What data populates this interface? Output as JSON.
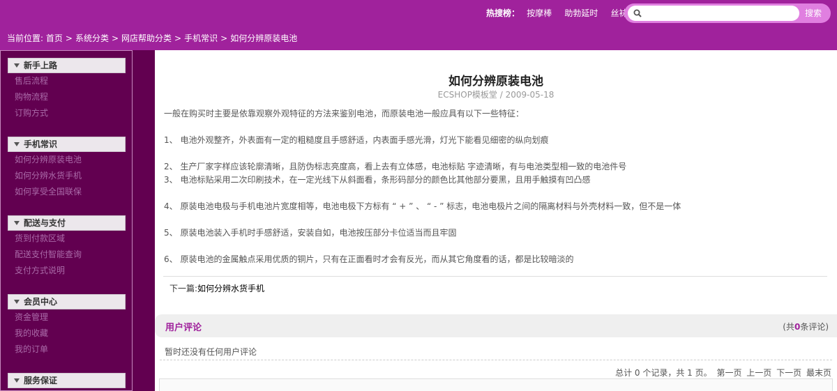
{
  "header": {
    "hot_label": "热搜榜：",
    "hot_links": [
      "按摩棒",
      "助勃延时",
      "丝袜"
    ],
    "search_placeholder": "",
    "search_button": "搜索"
  },
  "breadcrumb": {
    "prefix": "当前位置:",
    "items": [
      "首页",
      "系统分类",
      "网店帮助分类",
      "手机常识",
      "如何分辨原装电池"
    ],
    "separator": ">"
  },
  "sidebar": {
    "categories": [
      {
        "title": "新手上路",
        "items": [
          "售后流程",
          "购物流程",
          "订购方式"
        ]
      },
      {
        "title": "手机常识",
        "items": [
          "如何分辨原装电池",
          "如何分辨水货手机",
          "如何享受全国联保"
        ]
      },
      {
        "title": "配送与支付",
        "items": [
          "货到付款区域",
          "配送支付智能查询",
          "支付方式说明"
        ]
      },
      {
        "title": "会员中心",
        "items": [
          "资金管理",
          "我的收藏",
          "我的订单"
        ]
      },
      {
        "title": "服务保证",
        "items": []
      }
    ]
  },
  "article": {
    "title": "如何分辨原装电池",
    "meta": "ECSHOP模板堂 / 2009-05-18",
    "intro": "一般在购买时主要是依靠观察外观特征的方法来鉴别电池，而原装电池一般应具有以下一些特征：",
    "points": [
      "1、 电池外观整齐，外表面有一定的粗糙度且手感舒适，内表面手感光滑，灯光下能看见细密的纵向划痕",
      "2、 生产厂家字样应该轮廓清晰，且防伪标志亮度高，看上去有立体感，电池标贴 字迹清晰，有与电池类型相一致的电池件号",
      "3、 电池标贴采用二次印刷技术，在一定光线下从斜面看，条形码部分的颜色比其他部分要黑，且用手触摸有凹凸感",
      "4、 原装电池电极与手机电池片宽度相等，电池电极下方标有 “ + ” 、 “ - ” 标志，电池电极片之间的隔离材料与外壳材料一致，但不是一体",
      "5、 原装电池装入手机时手感舒适，安装自如，电池按压部分卡位适当而且牢固",
      "6、 原装电池的金属触点采用优质的铜片，只有在正面看时才会有反光，而从其它角度看的话，都是比较暗淡的"
    ],
    "next_label": "下一篇:",
    "next_title": "如何分辨水货手机"
  },
  "comments": {
    "title": "用户评论",
    "count_prefix": "(共",
    "count": "0",
    "count_suffix": "条评论)",
    "empty_text": "暂时还没有任何用户评论",
    "pager_info": "总计 0 个记录，共 1 页。",
    "pager_links": [
      "第一页",
      "上一页",
      "下一页",
      "最末页"
    ]
  },
  "colors": {
    "brand_purple": "#a0229c",
    "sidebar_dark": "#620050"
  }
}
